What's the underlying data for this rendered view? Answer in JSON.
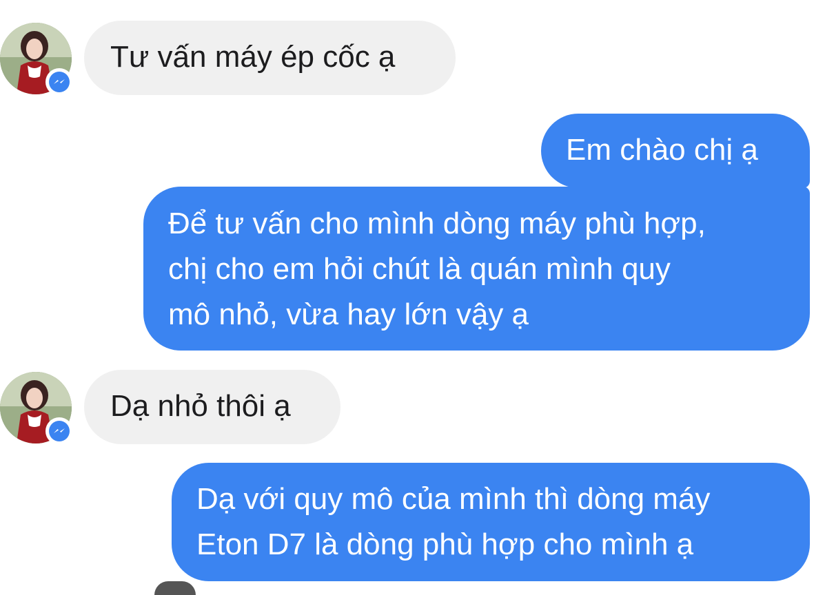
{
  "colors": {
    "outgoing_bubble": "#3b84f1",
    "incoming_bubble": "#f0f0f0",
    "messenger_badge": "#3b84f1"
  },
  "messages": [
    {
      "sender": "contact",
      "text": "Tư vấn máy ép cốc ạ"
    },
    {
      "sender": "me",
      "text": "Em chào chị ạ"
    },
    {
      "sender": "me",
      "lines": [
        "Để tư vấn cho mình dòng máy phù hợp,",
        "chị cho em hỏi chút là quán mình quy",
        "mô nhỏ, vừa hay lớn vậy ạ"
      ]
    },
    {
      "sender": "contact",
      "text": "Dạ nhỏ thôi ạ"
    },
    {
      "sender": "me",
      "lines": [
        "Dạ với quy mô của mình thì dòng máy",
        "Eton D7 là dòng phù hợp cho mình ạ"
      ]
    }
  ]
}
